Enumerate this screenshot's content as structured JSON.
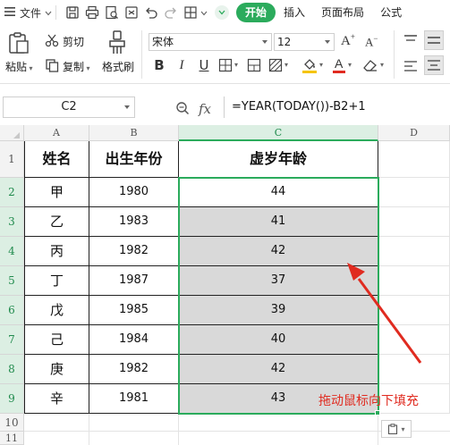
{
  "menubar": {
    "file_label": "文件",
    "tabs": [
      {
        "label": "开始",
        "active": true
      },
      {
        "label": "插入",
        "active": false
      },
      {
        "label": "页面布局",
        "active": false
      },
      {
        "label": "公式",
        "active": false
      }
    ]
  },
  "ribbon": {
    "paste_label": "粘贴",
    "cut_label": "剪切",
    "copy_label": "复制",
    "format_painter_label": "格式刷",
    "font_name": "宋体",
    "font_size": "12",
    "font_color": "#e02b20",
    "fill_color": "#f5c400"
  },
  "formula_bar": {
    "cell_ref": "C2",
    "fx_label": "fx",
    "formula": "=YEAR(TODAY())-B2+1"
  },
  "sheet": {
    "columns": [
      "A",
      "B",
      "C",
      "D"
    ],
    "rows": [
      "1",
      "2",
      "3",
      "4",
      "5",
      "6",
      "7",
      "8",
      "9",
      "10",
      "11"
    ],
    "headers": {
      "a": "姓名",
      "b": "出生年份",
      "c": "虚岁年龄"
    },
    "data": [
      {
        "name": "甲",
        "year": "1980",
        "age": "44"
      },
      {
        "name": "乙",
        "year": "1983",
        "age": "41"
      },
      {
        "name": "丙",
        "year": "1982",
        "age": "42"
      },
      {
        "name": "丁",
        "year": "1987",
        "age": "37"
      },
      {
        "name": "戊",
        "year": "1985",
        "age": "39"
      },
      {
        "name": "己",
        "year": "1984",
        "age": "40"
      },
      {
        "name": "庚",
        "year": "1982",
        "age": "42"
      },
      {
        "name": "辛",
        "year": "1981",
        "age": "43"
      }
    ],
    "selected_column": "C",
    "accent_color": "#2bab5c"
  },
  "annotation": {
    "text": "拖动鼠标向下填充",
    "color": "#e02b20"
  }
}
